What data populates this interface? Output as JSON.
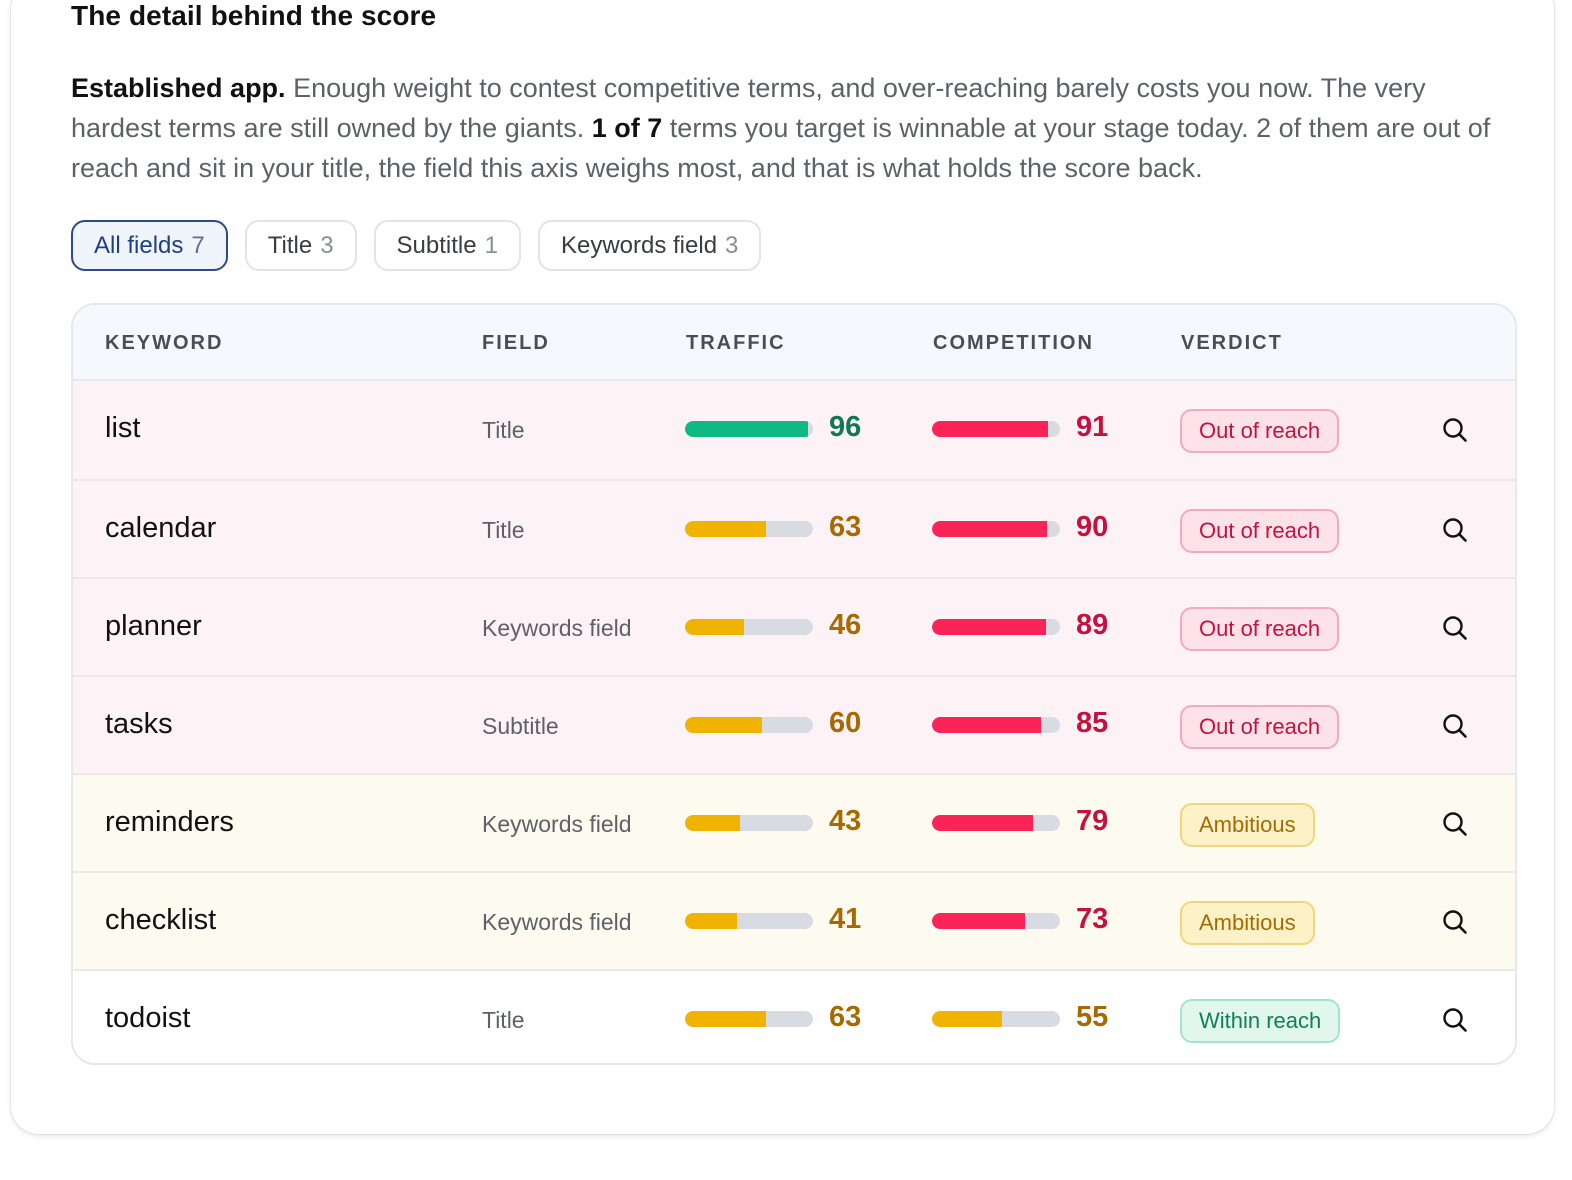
{
  "heading": "The detail behind the score",
  "description": {
    "lead": "Established app.",
    "text1": " Enough weight to contest competitive terms, and over-reaching barely costs you now. The very hardest terms are still owned by the giants. ",
    "emph": "1 of 7",
    "text2": " terms you target is winnable at your stage today. 2 of them are out of reach and sit in your title, the field this axis weighs most, and that is what holds the score back."
  },
  "filters": [
    {
      "label": "All fields",
      "count": "7",
      "active": true
    },
    {
      "label": "Title",
      "count": "3",
      "active": false
    },
    {
      "label": "Subtitle",
      "count": "1",
      "active": false
    },
    {
      "label": "Keywords field",
      "count": "3",
      "active": false
    }
  ],
  "table": {
    "headers": {
      "keyword": "KEYWORD",
      "field": "FIELD",
      "traffic": "TRAFFIC",
      "competition": "COMPETITION",
      "verdict": "VERDICT"
    },
    "rows": [
      {
        "keyword": "list",
        "field": "Title",
        "traffic": 96,
        "competition": 91,
        "verdict": "Out of reach",
        "tone": "red"
      },
      {
        "keyword": "calendar",
        "field": "Title",
        "traffic": 63,
        "competition": 90,
        "verdict": "Out of reach",
        "tone": "red"
      },
      {
        "keyword": "planner",
        "field": "Keywords field",
        "traffic": 46,
        "competition": 89,
        "verdict": "Out of reach",
        "tone": "red"
      },
      {
        "keyword": "tasks",
        "field": "Subtitle",
        "traffic": 60,
        "competition": 85,
        "verdict": "Out of reach",
        "tone": "red"
      },
      {
        "keyword": "reminders",
        "field": "Keywords field",
        "traffic": 43,
        "competition": 79,
        "verdict": "Ambitious",
        "tone": "amber"
      },
      {
        "keyword": "checklist",
        "field": "Keywords field",
        "traffic": 41,
        "competition": 73,
        "verdict": "Ambitious",
        "tone": "amber"
      },
      {
        "keyword": "todoist",
        "field": "Title",
        "traffic": 63,
        "competition": 55,
        "verdict": "Within reach",
        "tone": "green"
      }
    ]
  },
  "colors": {
    "green": "#10b981",
    "green_text": "#0f7a52",
    "amber": "#f0b400",
    "amber_text": "#a86a00",
    "red": "#fb2459",
    "red_text": "#c2123f",
    "accent": "#1f3f85"
  },
  "icons": {
    "row_action": "search-icon"
  }
}
